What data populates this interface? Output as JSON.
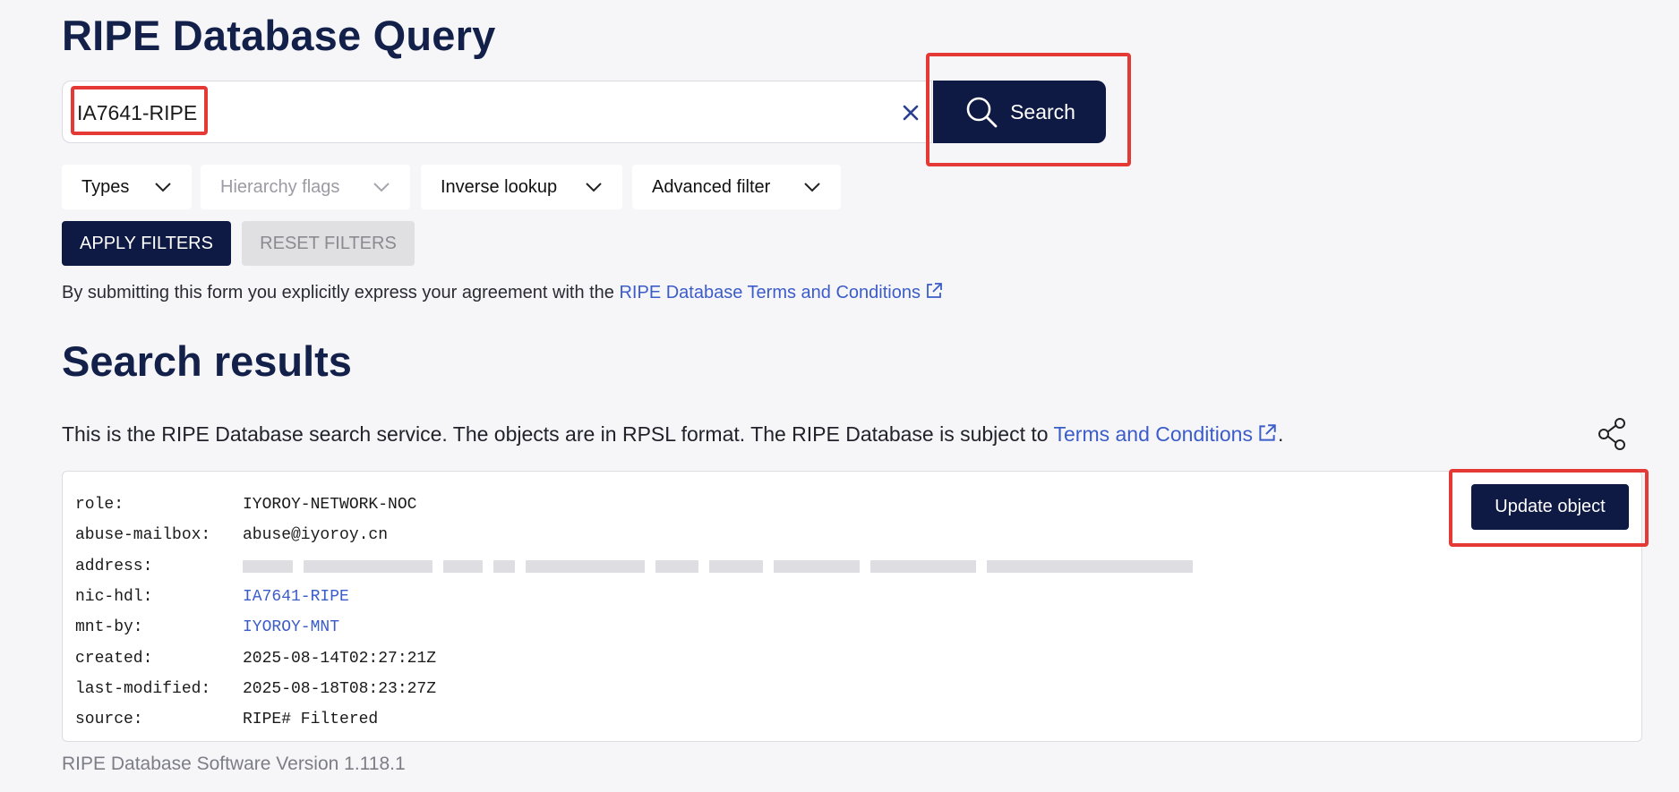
{
  "page": {
    "title": "RIPE Database Query"
  },
  "search": {
    "value": "IA7641-RIPE",
    "button_label": "Search"
  },
  "filters": {
    "items": [
      {
        "label": "Types"
      },
      {
        "label": "Hierarchy flags"
      },
      {
        "label": "Inverse lookup"
      },
      {
        "label": "Advanced filter"
      }
    ],
    "apply_label": "APPLY FILTERS",
    "reset_label": "RESET FILTERS"
  },
  "agreement": {
    "text": "By submitting this form you explicitly express your agreement with the ",
    "link": "RIPE Database Terms and Conditions"
  },
  "results": {
    "title": "Search results",
    "description": "This is the RIPE Database search service. The objects are in RPSL format. The RIPE Database is subject to ",
    "description_link": "Terms and Conditions",
    "description_end": ".",
    "update_label": "Update object",
    "rows": [
      {
        "key": "role:",
        "value": "IYOROY-NETWORK-NOC"
      },
      {
        "key": "abuse-mailbox:",
        "value": "abuse@iyoroy.cn"
      },
      {
        "key": "address:",
        "value": ""
      },
      {
        "key": "nic-hdl:",
        "value": "IA7641-RIPE"
      },
      {
        "key": "mnt-by:",
        "value": "IYOROY-MNT"
      },
      {
        "key": "created:",
        "value": "2025-08-14T02:27:21Z"
      },
      {
        "key": "last-modified:",
        "value": "2025-08-18T08:23:27Z"
      },
      {
        "key": "source:",
        "value": "RIPE# Filtered"
      }
    ]
  },
  "footer": {
    "version": "RIPE Database Software Version 1.118.1"
  },
  "colors": {
    "primary": "#0f1a44",
    "link": "#3b5cc9",
    "highlight": "#e53935",
    "background": "#f6f6f9"
  }
}
